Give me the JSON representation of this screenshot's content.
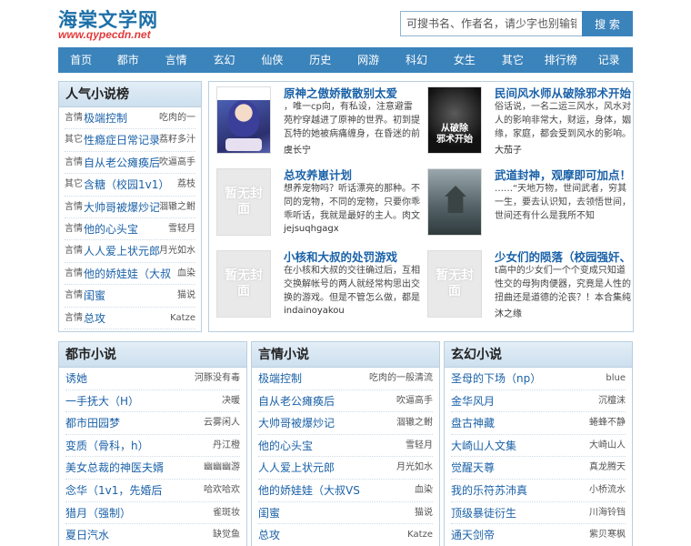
{
  "site": {
    "name": "海棠文学网",
    "url": "www.qypecdn.net"
  },
  "search": {
    "placeholder": "可搜书名、作者名，请少字也别输错字",
    "button": "搜 索"
  },
  "nav": [
    "首页",
    "都市",
    "言情",
    "玄幻",
    "仙侠",
    "历史",
    "网游",
    "科幻",
    "女生",
    "其它",
    "排行榜",
    "记录"
  ],
  "rank": {
    "title": "人气小说榜",
    "items": [
      {
        "cat": "言情",
        "title": "极端控制",
        "author": "吃肉的一"
      },
      {
        "cat": "其它",
        "title": "性瘾症日常记录",
        "author": "荔籽多汁"
      },
      {
        "cat": "言情",
        "title": "自从老公瘫痪后",
        "author": "吹逼高手"
      },
      {
        "cat": "其它",
        "title": "含糖（校园1v1）",
        "author": "荔枝"
      },
      {
        "cat": "言情",
        "title": "大帅哥被爆炒记",
        "author": "涸辙之鲋"
      },
      {
        "cat": "言情",
        "title": "他的心头宝",
        "author": "雪轻月"
      },
      {
        "cat": "言情",
        "title": "人人爱上状元郎",
        "author": "月光如水"
      },
      {
        "cat": "言情",
        "title": "他的娇娃娃（大叔",
        "author": "血染"
      },
      {
        "cat": "言情",
        "title": "闺蜜",
        "author": "猫说"
      },
      {
        "cat": "言情",
        "title": "总攻",
        "author": "Katze"
      }
    ]
  },
  "featured": [
    {
      "title": "原神之傲娇散散别太爱",
      "desc": "，唯一cp向，有私设，注意避雷苑柠穿越进了原神的世界。初到提瓦特的她被病痛缠身，在昏迷的前一秒被七七捡回了不卜庐，白术的救治",
      "author": "虞长宁",
      "cover": "art-blue"
    },
    {
      "title": "民间风水师从破除邪术开始",
      "desc": "俗话说，一名二运三风水，风水对人的影响非常大，财运，身体，姻缘，家庭，都会受到风水的影响。如果一个人很勤劳，不怕吃苦，兜",
      "author": "大茄子",
      "cover": "art-dark",
      "cover_text": "从破除\n邪术开始"
    },
    {
      "title": "总攻养崽计划",
      "desc": "想养宠物吗？听话漂亮的那种。不同的宠物，不同的宠物，只要你乖乖听话，我就是最好的主人。肉文里的双性弟弟 末世里的弟控",
      "author": "jejsuqhgagx",
      "cover": "noimg"
    },
    {
      "title": "武道封神，观摩即可加点！",
      "desc": "……“天地万物，世间武者，穷其一生，要去认识知，去领悟世间，世间还有什么是我所不知的…”“老爷子年后”李云站在巅峰处，再梧桐树下的莽汉",
      "author": "",
      "cover": "art-misty"
    },
    {
      "title": "小核和大叔的处罚游戏",
      "desc": "在小核和大叔的交往确过后，互相交换解帐号的两人就经常构思出交换的游戏。但是不管怎么做，都是体力佳，老二大，性技熟的大叔单方面",
      "author": "indainoyakou",
      "cover": "noimg"
    },
    {
      "title": "少女们的陨落（校园强奸、",
      "desc": "t高中的少女们一个个变成只知道性交的母狗肉便器，究竟是人性的扭曲还是道德的沦丧？！本合集纯黑暗向，无纯爱，不能接受请",
      "author": "沐之缘",
      "cover": "noimg"
    }
  ],
  "no_cover_text": "暂无封面",
  "columns": [
    {
      "title": "都市小说",
      "items": [
        {
          "title": "诱她",
          "author": "河豚没有毒"
        },
        {
          "title": "一手抚大（H）",
          "author": "决暖"
        },
        {
          "title": "都市田园梦",
          "author": "云雾闲人"
        },
        {
          "title": "变质（骨科，h）",
          "author": "丹江橙"
        },
        {
          "title": "美女总裁的神医夫婿",
          "author": "幽幽幽游"
        },
        {
          "title": "念华（1v1，先婚后",
          "author": "哈欢哈欢"
        },
        {
          "title": "猎月（强制）",
          "author": "雀斑妆"
        },
        {
          "title": "夏日汽水",
          "author": "缺觉鱼"
        }
      ]
    },
    {
      "title": "言情小说",
      "items": [
        {
          "title": "极端控制",
          "author": "吃肉的一般清流"
        },
        {
          "title": "自从老公瘫痪后",
          "author": "吹逼高手"
        },
        {
          "title": "大帅哥被爆炒记",
          "author": "涸辙之鲋"
        },
        {
          "title": "他的心头宝",
          "author": "雪轻月"
        },
        {
          "title": "人人爱上状元郎",
          "author": "月光如水"
        },
        {
          "title": "他的娇娃娃（大叔VS",
          "author": "血染"
        },
        {
          "title": "闺蜜",
          "author": "猫说"
        },
        {
          "title": "总攻",
          "author": "Katze"
        }
      ]
    },
    {
      "title": "玄幻小说",
      "items": [
        {
          "title": "圣母的下场（np）",
          "author": "blue"
        },
        {
          "title": "金华风月",
          "author": "沉檀沫"
        },
        {
          "title": "盘古神藏",
          "author": "蜷蜂不静"
        },
        {
          "title": "大崎山人文集",
          "author": "大崎山人"
        },
        {
          "title": "觉醒天尊",
          "author": "真龙腾天"
        },
        {
          "title": "我的乐符苏沛真",
          "author": "小桥流水"
        },
        {
          "title": "顶级暴徒衍生",
          "author": "川海铃铛"
        },
        {
          "title": "通天剑帝",
          "author": "紫贝寒枫"
        }
      ]
    }
  ]
}
